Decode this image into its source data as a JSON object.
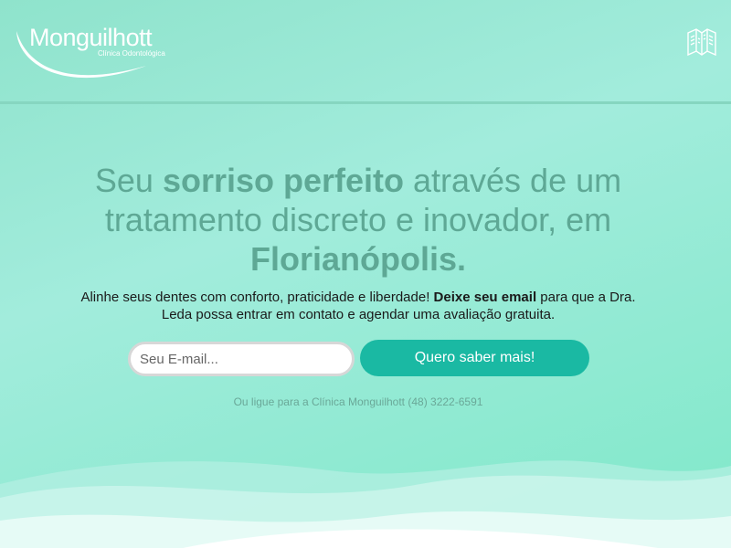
{
  "header": {
    "logo_name": "Monguilhott",
    "logo_subtitle": "Clínica Odontológica",
    "menu_icon": "map-guide-icon"
  },
  "hero": {
    "headline_part1": "Seu ",
    "headline_bold1": "sorriso perfeito",
    "headline_part2": " através de um tratamento discreto e inovador, em ",
    "headline_bold2": "Florianópolis.",
    "subtext_part1": "Alinhe seus dentes com conforto, praticidade e liberdade! ",
    "subtext_bold": "Deixe seu email",
    "subtext_part2": " para que a Dra. Leda possa entrar em contato e agendar uma avaliação gratuita."
  },
  "form": {
    "email_placeholder": "Seu E-mail...",
    "email_value": "",
    "submit_label": "Quero saber mais!"
  },
  "footer_note": "Ou ligue para a Clínica Monguilhott (48) 3222-6591",
  "colors": {
    "accent": "#1ab9a3",
    "headline": "#5ea895",
    "background": "#8fe3cc"
  }
}
